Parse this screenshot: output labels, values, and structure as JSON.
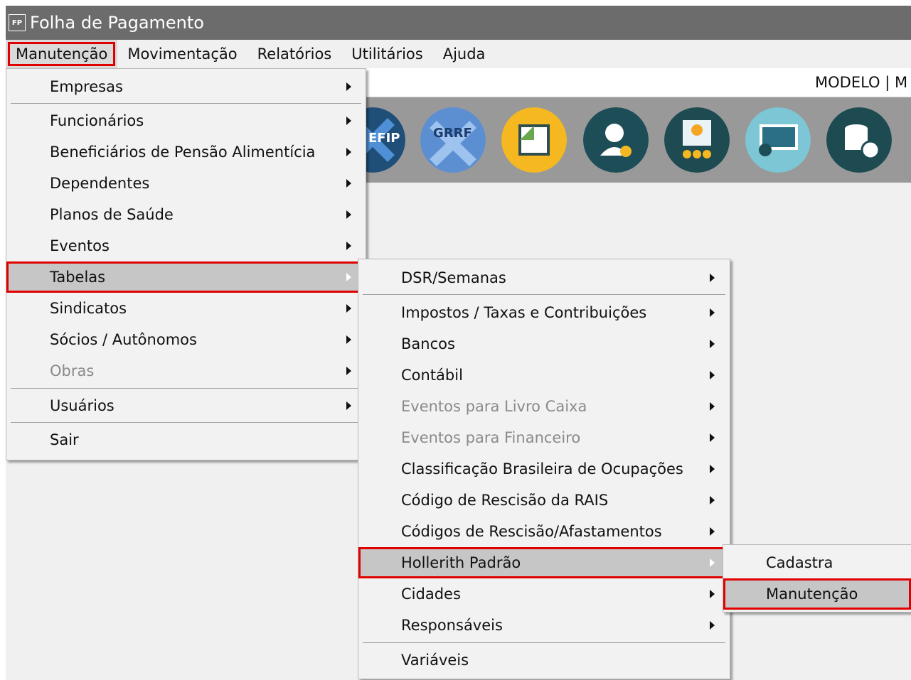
{
  "window": {
    "title": "Folha de Pagamento",
    "icon_text": "FP"
  },
  "menubar": [
    "Manutenção",
    "Movimentação",
    "Relatórios",
    "Utilitários",
    "Ajuda"
  ],
  "info": {
    "text": "MODELO | M"
  },
  "toolbar": {
    "sefip_text": "EFIP",
    "grrf_text": "GRRF"
  },
  "menu1": {
    "items": [
      "Empresas",
      "Funcionários",
      "Beneficiários de Pensão Alimentícia",
      "Dependentes",
      "Planos de Saúde",
      "Eventos",
      "Tabelas",
      "Sindicatos",
      "Sócios / Autônomos",
      "Obras",
      "Usuários",
      "Sair"
    ]
  },
  "menu2": {
    "items": [
      "DSR/Semanas",
      "Impostos / Taxas e Contribuições",
      "Bancos",
      "Contábil",
      "Eventos para Livro Caixa",
      "Eventos para Financeiro",
      "Classificação Brasileira de Ocupações",
      "Código de Rescisão da RAIS",
      "Códigos de Rescisão/Afastamentos",
      "Hollerith Padrão",
      "Cidades",
      "Responsáveis",
      "Variáveis"
    ]
  },
  "menu3": {
    "items": [
      "Cadastra",
      "Manutenção"
    ]
  },
  "colors": {
    "highlight_border": "#e00000",
    "titlebar": "#6c6c6c",
    "toolbar": "#999999"
  }
}
